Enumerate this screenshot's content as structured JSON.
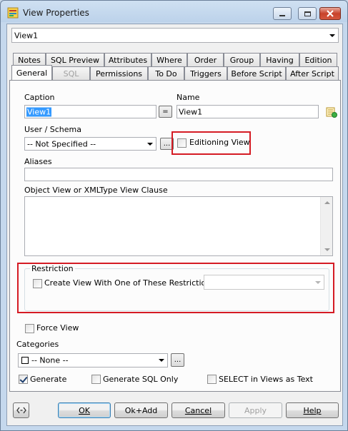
{
  "window": {
    "title": "View Properties",
    "minimize_icon": "minimize-icon",
    "maximize_icon": "maximize-icon",
    "close_icon": "close-icon"
  },
  "object_selector": {
    "value": "View1"
  },
  "tabs_row1": [
    "Notes",
    "SQL Preview",
    "Attributes",
    "Where",
    "Order",
    "Group",
    "Having",
    "Edition"
  ],
  "tabs_row2": [
    "General",
    "SQL",
    "Permissions",
    "To Do",
    "Triggers",
    "Before Script",
    "After Script"
  ],
  "active_tab": "General",
  "general": {
    "caption_label": "Caption",
    "caption_value": "View1",
    "equals_button": "=",
    "name_label": "Name",
    "name_value": "View1",
    "user_schema_label": "User / Schema",
    "user_schema_value": "-- Not Specified --",
    "browse_button": "...",
    "editioning_view_label": "Editioning View",
    "aliases_label": "Aliases",
    "aliases_value": "",
    "object_view_label": "Object View or XMLType View Clause",
    "restriction_group_label": "Restriction",
    "restriction_checkbox_label": "Create View With One of These Restrictions:",
    "restriction_value": "",
    "force_view_label": "Force View",
    "categories_label": "Categories",
    "categories_value": "-- None --",
    "categories_browse_button": "...",
    "generate_label": "Generate",
    "generate_checked": true,
    "generate_sql_only_label": "Generate SQL Only",
    "select_in_views_label": "SELECT in Views as Text"
  },
  "footer": {
    "ok": "OK",
    "ok_add": "Ok+Add",
    "cancel": "Cancel",
    "apply": "Apply",
    "help": "Help"
  },
  "colors": {
    "highlight": "#d51b24",
    "selection": "#3399ff"
  }
}
